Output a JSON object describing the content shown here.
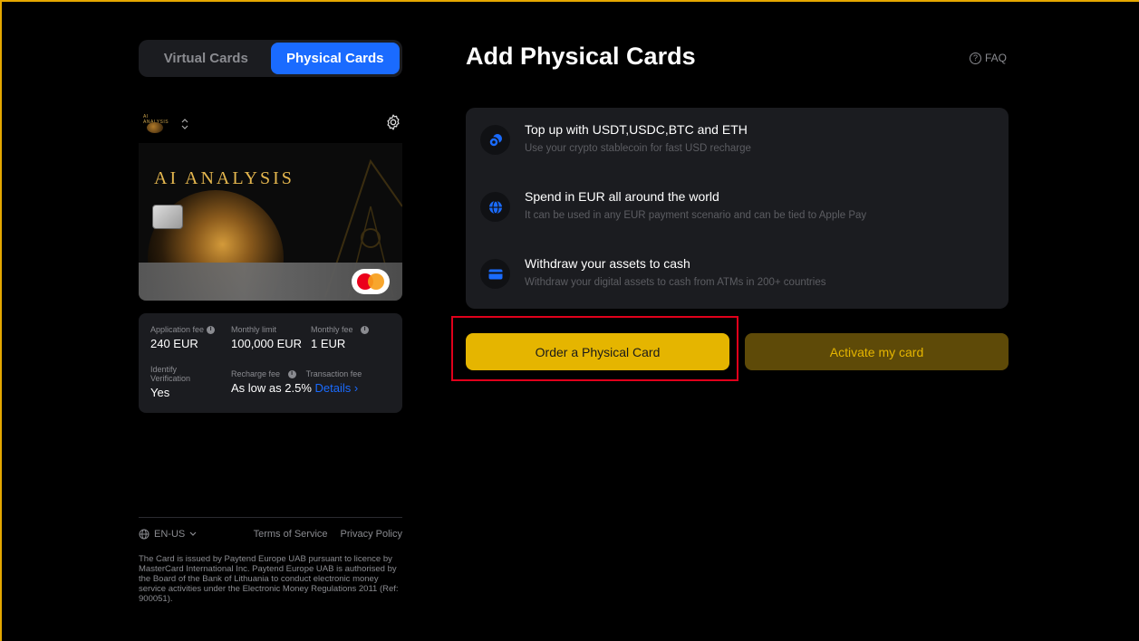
{
  "tabs": {
    "virtual": "Virtual Cards",
    "physical": "Physical Cards",
    "active": "physical"
  },
  "card": {
    "logo_text": "AI ANALYSIS",
    "title": "AI ANALYSIS",
    "icons": [
      "chevron-updown-icon",
      "gear-icon",
      "mastercard-logo"
    ]
  },
  "info": {
    "application_fee_label": "Application fee",
    "application_fee": "240 EUR",
    "monthly_limit_label": "Monthly limit",
    "monthly_limit": "100,000 EUR",
    "monthly_fee_label": "Monthly fee",
    "monthly_fee": "1 EUR",
    "identify_label_1": "Identify",
    "identify_label_2": "Verification",
    "identify": "Yes",
    "recharge_fee_label": "Recharge fee",
    "transaction_fee_label": "Transaction fee",
    "recharge_fee": "As low as 2.5%",
    "details_link": "Details ›"
  },
  "footer": {
    "language": "EN-US",
    "terms": "Terms of Service",
    "privacy": "Privacy Policy",
    "legal": "The Card is issued by Paytend Europe UAB pursuant to licence by MasterCard International Inc. Paytend Europe UAB is authorised by the Board of the Bank of Lithuania to conduct electronic money service activities under the Electronic Money Regulations 2011 (Ref: 900051)."
  },
  "main": {
    "title": "Add Physical Cards",
    "faq": "FAQ",
    "features": [
      {
        "title": "Top up with USDT,USDC,BTC and ETH",
        "desc": "Use your crypto stablecoin for fast USD recharge",
        "icon": "coins-icon"
      },
      {
        "title": "Spend in EUR all around the world",
        "desc": "It can be used in any EUR payment scenario and can be tied to Apple Pay",
        "icon": "globe-icon"
      },
      {
        "title": "Withdraw your assets to cash",
        "desc": "Withdraw your digital assets to cash from ATMs in 200+ countries",
        "icon": "card-icon"
      }
    ],
    "order_button": "Order a Physical Card",
    "activate_button": "Activate my card"
  },
  "colors": {
    "accent_blue": "#1a6bff",
    "gold": "#e5b500",
    "highlight_red": "#e0001b"
  }
}
